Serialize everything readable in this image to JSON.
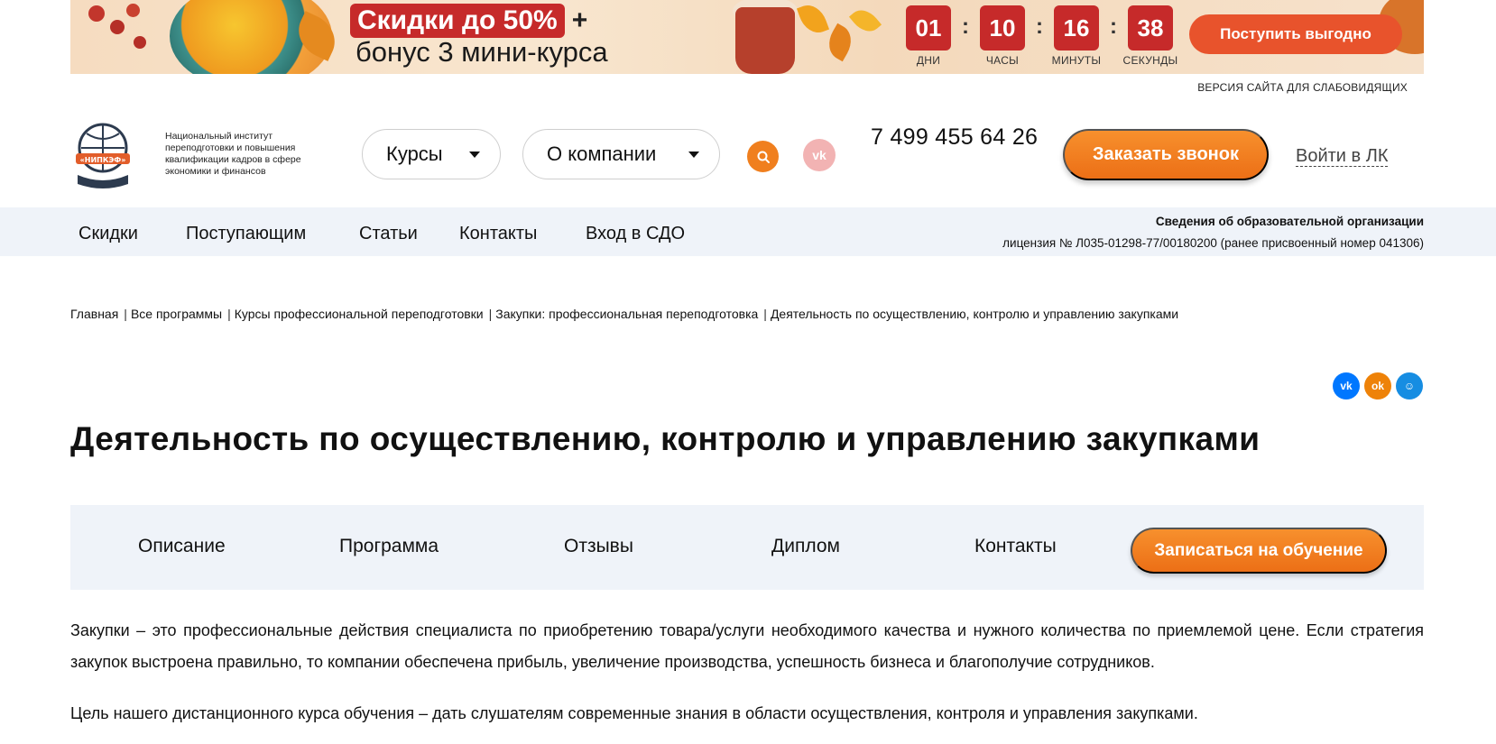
{
  "banner": {
    "sale_text": "Скидки до 50%",
    "plus": "+",
    "bonus_text": "бонус 3 мини-курса",
    "countdown": [
      {
        "value": "01",
        "label": "ДНИ"
      },
      {
        "value": "10",
        "label": "ЧАСЫ"
      },
      {
        "value": "16",
        "label": "МИНУТЫ"
      },
      {
        "value": "38",
        "label": "СЕКУНДЫ"
      }
    ],
    "separator": ":",
    "cta_label": "Поступить выгодно"
  },
  "accessibility_link": "ВЕРСИЯ САЙТА ДЛЯ СЛАБОВИДЯЩИХ",
  "header": {
    "logo_caption": "«НИПКЭФ»",
    "institute_name": "Национальный институт переподготовки и повышения квалификации кадров в сфере экономики и финансов",
    "courses_label": "Курсы",
    "company_label": "О компании",
    "vk_label": "vk",
    "phone": "7 499 455 64 26",
    "callback_label": "Заказать звонок",
    "login_label": "Войти в ЛК"
  },
  "nav": {
    "items": [
      "Скидки",
      "Поступающим",
      "Статьи",
      "Контакты",
      "Вход в СДО"
    ],
    "org_info": "Сведения об образовательной организации",
    "license": "лицензия № Л035-01298-77/00180200 (ранее присвоенный номер 041306)"
  },
  "breadcrumb": [
    "Главная",
    "Все программы",
    "Курсы профессиональной переподготовки",
    "Закупки: профессиональная переподготовка",
    "Деятельность по осуществлению, контролю и управлению закупками"
  ],
  "share": [
    {
      "label": "vk",
      "icon": "vk-icon",
      "color": "#0077ff"
    },
    {
      "label": "ok",
      "icon": "odnoklassniki-icon",
      "color": "#ee8208"
    },
    {
      "label": "☺",
      "icon": "moimir-icon",
      "color": "#168de2"
    }
  ],
  "page_title": "Деятельность по осуществлению, контролю и управлению закупками",
  "tabs": {
    "items": [
      "Описание",
      "Программа",
      "Отзывы",
      "Диплом",
      "Контакты"
    ],
    "enroll_label": "Записаться на обучение"
  },
  "content": {
    "paragraph1": "Закупки – это профессиональные действия специалиста по приобретению товара/услуги необходимого качества и нужного количества по приемлемой цене. Если стратегия закупок выстроена правильно, то компании обеспечена прибыль, увеличение производства, успешность бизнеса и благополучие сотрудников.",
    "paragraph2": "Цель нашего дистанционного курса обучения – дать слушателям современные знания в области осуществления, контроля и управления закупками."
  },
  "colors": {
    "accent_orange": "#ec6f16",
    "banner_red": "#c62a2a",
    "light_panel": "#eff3f9"
  }
}
